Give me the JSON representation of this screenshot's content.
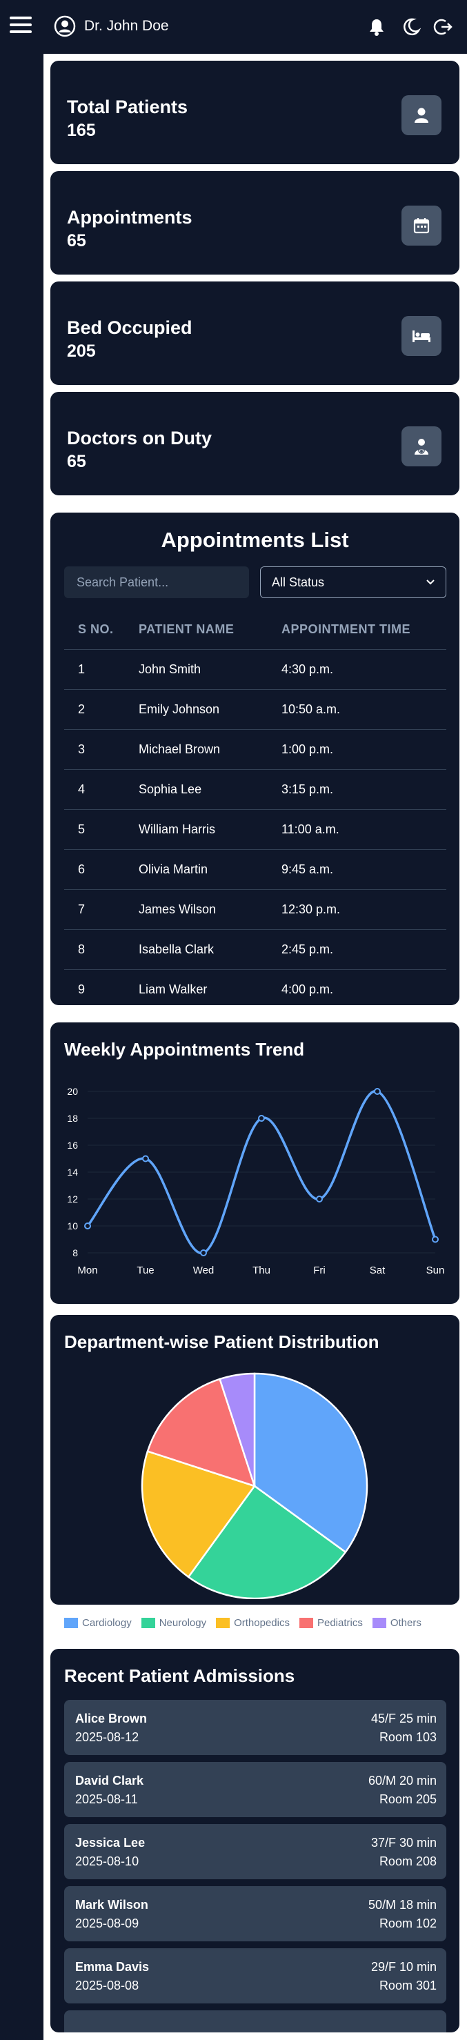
{
  "header": {
    "user_name": "Dr. John Doe"
  },
  "stats": [
    {
      "label": "Total Patients",
      "value": "165",
      "icon": "user-icon"
    },
    {
      "label": "Appointments",
      "value": "65",
      "icon": "calendar-icon"
    },
    {
      "label": "Bed Occupied",
      "value": "205",
      "icon": "bed-icon"
    },
    {
      "label": "Doctors on Duty",
      "value": "65",
      "icon": "doctor-icon"
    }
  ],
  "appointments": {
    "title": "Appointments List",
    "search_placeholder": "Search Patient...",
    "status_selected": "All Status",
    "columns": [
      "S NO.",
      "PATIENT NAME",
      "APPOINTMENT TIME"
    ],
    "rows": [
      [
        "1",
        "John Smith",
        "4:30 p.m."
      ],
      [
        "2",
        "Emily Johnson",
        "10:50 a.m."
      ],
      [
        "3",
        "Michael Brown",
        "1:00 p.m."
      ],
      [
        "4",
        "Sophia Lee",
        "3:15 p.m."
      ],
      [
        "5",
        "William Harris",
        "11:00 a.m."
      ],
      [
        "6",
        "Olivia Martin",
        "9:45 a.m."
      ],
      [
        "7",
        "James Wilson",
        "12:30 p.m."
      ],
      [
        "8",
        "Isabella Clark",
        "2:45 p.m."
      ],
      [
        "9",
        "Liam Walker",
        "4:00 p.m."
      ]
    ]
  },
  "colors": {
    "background": "#0f172a",
    "line": "#60a5fa",
    "slices": [
      "#60a5fa",
      "#34d399",
      "#fbbf24",
      "#f87171",
      "#a78bfa"
    ]
  },
  "chart_data": [
    {
      "type": "line",
      "title": "Weekly Appointments Trend",
      "categories": [
        "Mon",
        "Tue",
        "Wed",
        "Thu",
        "Fri",
        "Sat",
        "Sun"
      ],
      "values": [
        10,
        15,
        8,
        18,
        12,
        20,
        9
      ],
      "ylim": [
        8,
        20
      ],
      "yticks": [
        "8",
        "10",
        "12",
        "14",
        "16",
        "18",
        "20"
      ],
      "grid": true
    },
    {
      "type": "pie",
      "title": "Department-wise Patient Distribution",
      "labels": [
        "Cardiology",
        "Neurology",
        "Orthopedics",
        "Pediatrics",
        "Others"
      ],
      "values": [
        35,
        25,
        20,
        15,
        5
      ],
      "legend": "bottom"
    }
  ],
  "admissions": {
    "title": "Recent Patient Admissions",
    "items": [
      {
        "name": "Alice Brown",
        "date": "2025-08-12",
        "meta": "45/F 25 min",
        "room": "Room 103"
      },
      {
        "name": "David Clark",
        "date": "2025-08-11",
        "meta": "60/M 20 min",
        "room": "Room 205"
      },
      {
        "name": "Jessica Lee",
        "date": "2025-08-10",
        "meta": "37/F 30 min",
        "room": "Room 208"
      },
      {
        "name": "Mark Wilson",
        "date": "2025-08-09",
        "meta": "50/M 18 min",
        "room": "Room 102"
      },
      {
        "name": "Emma Davis",
        "date": "2025-08-08",
        "meta": "29/F 10 min",
        "room": "Room 301"
      }
    ]
  }
}
